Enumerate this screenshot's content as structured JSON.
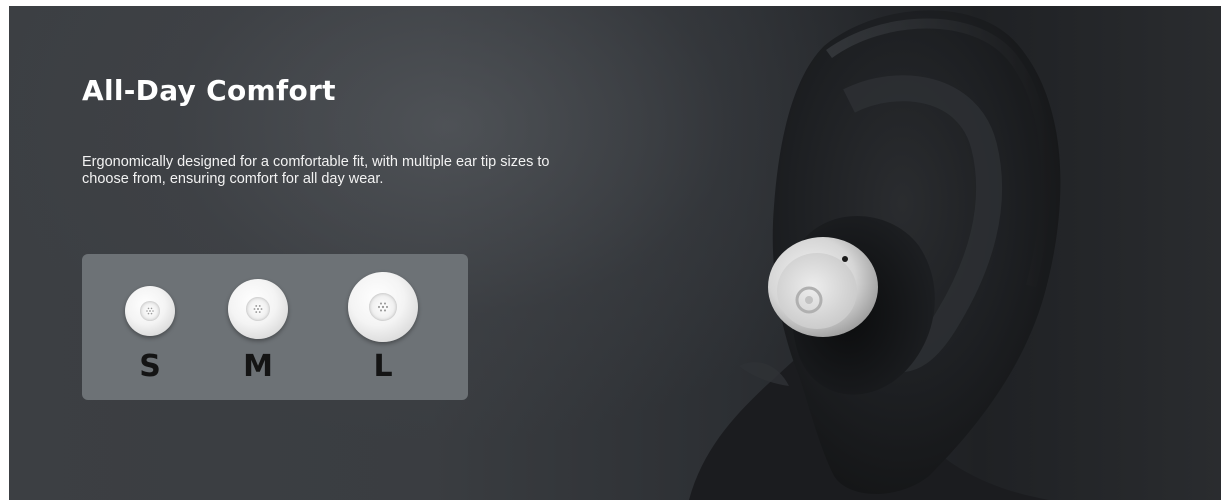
{
  "hero": {
    "title": "All-Day Comfort",
    "description": "Ergonomically designed for a comfortable fit, with multiple ear tip sizes to choose from, ensuring comfort for all day wear."
  },
  "ear_tips": [
    {
      "label": "S"
    },
    {
      "label": "M"
    },
    {
      "label": "L"
    }
  ],
  "colors": {
    "background": "#2e3135",
    "panel": "#6d7276",
    "title_text": "#ffffff",
    "tip_label": "#141414",
    "earbud": "#e8e8e8"
  }
}
